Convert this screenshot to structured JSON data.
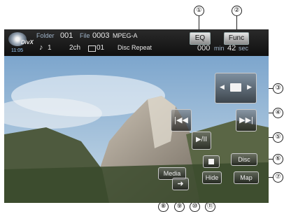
{
  "callouts": {
    "c1": "①",
    "c2": "②",
    "c3": "③",
    "c4": "④",
    "c5": "⑤",
    "c6": "⑥",
    "c7": "⑦",
    "c8": "⑧",
    "c9": "⑨",
    "c10": "⑩",
    "c11": "⑪"
  },
  "status": {
    "disc_badge": "DivX",
    "disc_time": "11:05",
    "folder_label": "Folder",
    "folder_value": "001",
    "file_label": "File",
    "file_value": "0003",
    "file_format": "MPEG-A",
    "track_value": "1",
    "channels": "2ch",
    "subtitle_value": "01",
    "repeat_mode": "Disc Repeat",
    "time_min_value": "000",
    "time_min_label": "min",
    "time_sec_value": "42",
    "time_sec_label": "sec"
  },
  "buttons": {
    "eq": "EQ",
    "func": "Func",
    "media": "Media",
    "disc": "Disc",
    "map": "Map",
    "hide": "Hide"
  },
  "icons": {
    "folder_select": "folder-left-right-icon",
    "prev_track": "skip-back-icon",
    "next_track": "skip-forward-icon",
    "play_pause": "play-pause-icon",
    "stop": "stop-icon",
    "search": "arrow-right-icon",
    "disc": "disc-icon",
    "note": "music-note-icon",
    "subtitle": "subtitle-icon"
  }
}
